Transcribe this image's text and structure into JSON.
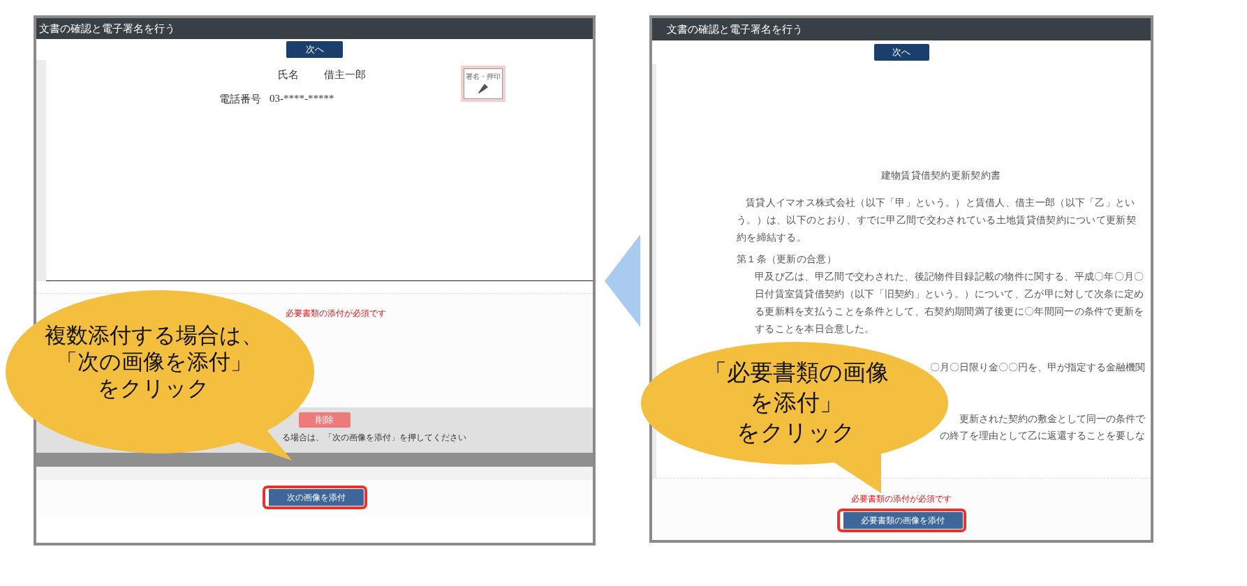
{
  "left_screen": {
    "title": "文書の確認と電子署名を行う",
    "next_button": "次へ",
    "name_label": "氏名",
    "name_value": "借主一郎",
    "phone_label": "電話番号",
    "phone_value": "03-****-*****",
    "stamp_label": "署名・押印",
    "required_notice": "必要書類の添付が必須です",
    "delete_button": "削除",
    "instruction": "る場合は、「次の画像を添付」を押してください",
    "attach_button": "次の画像を添付",
    "attach_highlighted": true,
    "callout": [
      "複数添付する場合は、",
      "「次の画像を添付」",
      "をクリック"
    ]
  },
  "right_screen": {
    "title": "文書の確認と電子署名を行う",
    "next_button": "次へ",
    "document": {
      "lines": [
        {
          "kind": "title",
          "text": "建物賃貸借契約更新契約書"
        },
        {
          "kind": "first",
          "text": "賃貸人イマオス株式会社（以下「甲」という。）と賃借人、借主一郎（以下「乙」とい"
        },
        {
          "kind": "body",
          "text": "う。）は、以下のとおり、すでに甲乙間で交わされている土地賃貸借契約について更新契"
        },
        {
          "kind": "body",
          "text": "約を締結する。"
        },
        {
          "kind": "heading",
          "text": "第１条（更新の合意）"
        },
        {
          "kind": "indent",
          "text": "甲及び乙は、甲乙間で交わされた、後記物件目録記載の物件に関する、平成〇年〇月〇"
        },
        {
          "kind": "indent",
          "text": "日付賃室賃貸借契約（以下「旧契約」という。）について、乙が甲に対して次条に定め"
        },
        {
          "kind": "indent",
          "text": "る更新料を支払うことを条件として、右契約期間満了後更に〇年間同一の条件で更新を"
        },
        {
          "kind": "indent",
          "text": "することを本日合意した。"
        }
      ],
      "partial_lines": [
        "〇月〇日限り金〇〇円を、甲が指定する金融機関",
        "更新された契約の敷金として同一の条件で",
        "の終了を理由として乙に返還することを要しな"
      ]
    },
    "required_notice": "必要書類の添付が必須です",
    "attach_button": "必要書類の画像を添付",
    "attach_highlighted": true,
    "callout": [
      "「必要書類の画像",
      "を添付」",
      "をクリック"
    ]
  }
}
